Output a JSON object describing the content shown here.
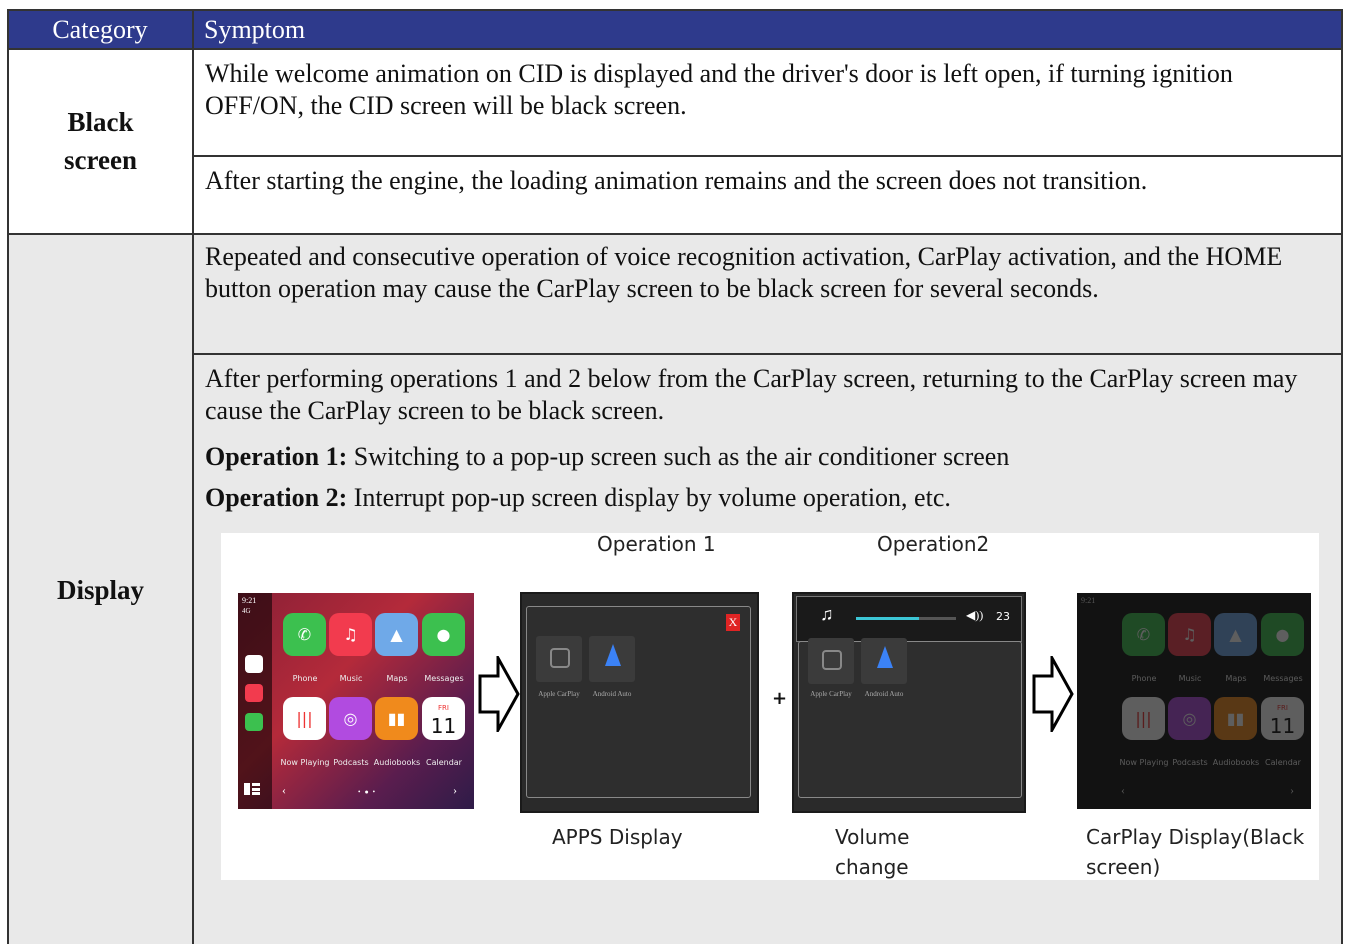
{
  "header": {
    "category": "Category",
    "symptom": "Symptom"
  },
  "rows": [
    {
      "category": "Black\nscreen",
      "symptoms": [
        "While welcome animation on CID is displayed and the driver's door is left open, if turning ignition OFF/ON, the CID screen will be black screen.",
        "After starting the engine, the loading animation remains and the screen does not transition."
      ]
    },
    {
      "category": "Display",
      "symptoms": [
        "Repeated and consecutive operation of voice recognition activation, CarPlay activation, and the HOME button operation may cause the CarPlay screen to be black screen for several seconds.",
        "After performing operations 1 and 2 below from the CarPlay screen, returning to the CarPlay screen may cause the CarPlay screen to be black screen."
      ],
      "operations": [
        {
          "label": "Operation 1:",
          "text": " Switching to a pop-up screen such as the air conditioner screen"
        },
        {
          "label": "Operation 2:",
          "text": " Interrupt pop-up screen display by volume operation, etc."
        }
      ]
    }
  ],
  "figure": {
    "op1_label": "Operation 1",
    "op2_label": "Operation2",
    "plus": "+",
    "captions": [
      "APPS Display",
      "Volume change",
      "CarPlay Display(Black screen)"
    ],
    "carplay": {
      "time": "9:21",
      "signal": "4G",
      "apps": [
        {
          "label": "Phone",
          "color": "#3cc04f",
          "icon": "phone-icon",
          "glyph": "✆"
        },
        {
          "label": "Music",
          "color": "#f23b4e",
          "icon": "music-icon",
          "glyph": "♫"
        },
        {
          "label": "Maps",
          "color": "#6fa9e8",
          "icon": "maps-icon",
          "glyph": "▲"
        },
        {
          "label": "Messages",
          "color": "#3cc04f",
          "icon": "messages-icon",
          "glyph": "●"
        },
        {
          "label": "Now Playing",
          "color": "#ffffff",
          "icon": "now-playing-icon",
          "glyph": "|||"
        },
        {
          "label": "Podcasts",
          "color": "#b14be0",
          "icon": "podcasts-icon",
          "glyph": "◎"
        },
        {
          "label": "Audiobooks",
          "color": "#f08a1c",
          "icon": "audiobooks-icon",
          "glyph": "▮▮"
        },
        {
          "label": "Calendar",
          "color": "#ffffff",
          "icon": "calendar-icon",
          "glyph": "11"
        }
      ],
      "calendar_day": "FRI",
      "calendar_date": "11"
    },
    "apps_screen": {
      "close": "X",
      "tiles": [
        "Apple CarPlay",
        "Android Auto"
      ]
    },
    "volume_screen": {
      "value": "23",
      "tiles": [
        "Apple CarPlay",
        "Android Auto"
      ]
    }
  },
  "colors": {
    "header_bg": "#2e3a8c",
    "cell_gray": "#e9e9e9"
  }
}
